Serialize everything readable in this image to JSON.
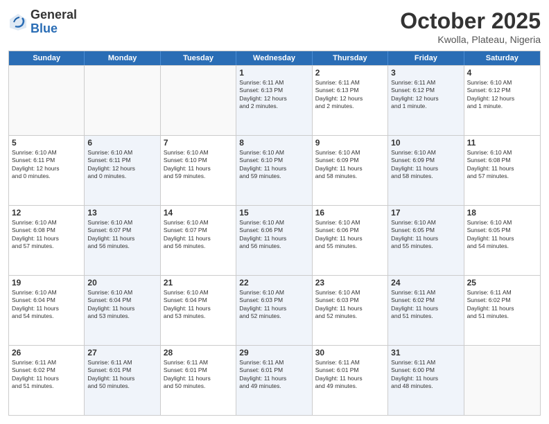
{
  "header": {
    "logo_general": "General",
    "logo_blue": "Blue",
    "month": "October 2025",
    "location": "Kwolla, Plateau, Nigeria"
  },
  "weekdays": [
    "Sunday",
    "Monday",
    "Tuesday",
    "Wednesday",
    "Thursday",
    "Friday",
    "Saturday"
  ],
  "rows": [
    [
      {
        "day": "",
        "info": "",
        "empty": true
      },
      {
        "day": "",
        "info": "",
        "empty": true
      },
      {
        "day": "",
        "info": "",
        "empty": true
      },
      {
        "day": "1",
        "info": "Sunrise: 6:11 AM\nSunset: 6:13 PM\nDaylight: 12 hours\nand 2 minutes.",
        "shaded": true
      },
      {
        "day": "2",
        "info": "Sunrise: 6:11 AM\nSunset: 6:13 PM\nDaylight: 12 hours\nand 2 minutes.",
        "shaded": false
      },
      {
        "day": "3",
        "info": "Sunrise: 6:11 AM\nSunset: 6:12 PM\nDaylight: 12 hours\nand 1 minute.",
        "shaded": true
      },
      {
        "day": "4",
        "info": "Sunrise: 6:10 AM\nSunset: 6:12 PM\nDaylight: 12 hours\nand 1 minute.",
        "shaded": false
      }
    ],
    [
      {
        "day": "5",
        "info": "Sunrise: 6:10 AM\nSunset: 6:11 PM\nDaylight: 12 hours\nand 0 minutes.",
        "shaded": false
      },
      {
        "day": "6",
        "info": "Sunrise: 6:10 AM\nSunset: 6:11 PM\nDaylight: 12 hours\nand 0 minutes.",
        "shaded": true
      },
      {
        "day": "7",
        "info": "Sunrise: 6:10 AM\nSunset: 6:10 PM\nDaylight: 11 hours\nand 59 minutes.",
        "shaded": false
      },
      {
        "day": "8",
        "info": "Sunrise: 6:10 AM\nSunset: 6:10 PM\nDaylight: 11 hours\nand 59 minutes.",
        "shaded": true
      },
      {
        "day": "9",
        "info": "Sunrise: 6:10 AM\nSunset: 6:09 PM\nDaylight: 11 hours\nand 58 minutes.",
        "shaded": false
      },
      {
        "day": "10",
        "info": "Sunrise: 6:10 AM\nSunset: 6:09 PM\nDaylight: 11 hours\nand 58 minutes.",
        "shaded": true
      },
      {
        "day": "11",
        "info": "Sunrise: 6:10 AM\nSunset: 6:08 PM\nDaylight: 11 hours\nand 57 minutes.",
        "shaded": false
      }
    ],
    [
      {
        "day": "12",
        "info": "Sunrise: 6:10 AM\nSunset: 6:08 PM\nDaylight: 11 hours\nand 57 minutes.",
        "shaded": false
      },
      {
        "day": "13",
        "info": "Sunrise: 6:10 AM\nSunset: 6:07 PM\nDaylight: 11 hours\nand 56 minutes.",
        "shaded": true
      },
      {
        "day": "14",
        "info": "Sunrise: 6:10 AM\nSunset: 6:07 PM\nDaylight: 11 hours\nand 56 minutes.",
        "shaded": false
      },
      {
        "day": "15",
        "info": "Sunrise: 6:10 AM\nSunset: 6:06 PM\nDaylight: 11 hours\nand 56 minutes.",
        "shaded": true
      },
      {
        "day": "16",
        "info": "Sunrise: 6:10 AM\nSunset: 6:06 PM\nDaylight: 11 hours\nand 55 minutes.",
        "shaded": false
      },
      {
        "day": "17",
        "info": "Sunrise: 6:10 AM\nSunset: 6:05 PM\nDaylight: 11 hours\nand 55 minutes.",
        "shaded": true
      },
      {
        "day": "18",
        "info": "Sunrise: 6:10 AM\nSunset: 6:05 PM\nDaylight: 11 hours\nand 54 minutes.",
        "shaded": false
      }
    ],
    [
      {
        "day": "19",
        "info": "Sunrise: 6:10 AM\nSunset: 6:04 PM\nDaylight: 11 hours\nand 54 minutes.",
        "shaded": false
      },
      {
        "day": "20",
        "info": "Sunrise: 6:10 AM\nSunset: 6:04 PM\nDaylight: 11 hours\nand 53 minutes.",
        "shaded": true
      },
      {
        "day": "21",
        "info": "Sunrise: 6:10 AM\nSunset: 6:04 PM\nDaylight: 11 hours\nand 53 minutes.",
        "shaded": false
      },
      {
        "day": "22",
        "info": "Sunrise: 6:10 AM\nSunset: 6:03 PM\nDaylight: 11 hours\nand 52 minutes.",
        "shaded": true
      },
      {
        "day": "23",
        "info": "Sunrise: 6:10 AM\nSunset: 6:03 PM\nDaylight: 11 hours\nand 52 minutes.",
        "shaded": false
      },
      {
        "day": "24",
        "info": "Sunrise: 6:11 AM\nSunset: 6:02 PM\nDaylight: 11 hours\nand 51 minutes.",
        "shaded": true
      },
      {
        "day": "25",
        "info": "Sunrise: 6:11 AM\nSunset: 6:02 PM\nDaylight: 11 hours\nand 51 minutes.",
        "shaded": false
      }
    ],
    [
      {
        "day": "26",
        "info": "Sunrise: 6:11 AM\nSunset: 6:02 PM\nDaylight: 11 hours\nand 51 minutes.",
        "shaded": false
      },
      {
        "day": "27",
        "info": "Sunrise: 6:11 AM\nSunset: 6:01 PM\nDaylight: 11 hours\nand 50 minutes.",
        "shaded": true
      },
      {
        "day": "28",
        "info": "Sunrise: 6:11 AM\nSunset: 6:01 PM\nDaylight: 11 hours\nand 50 minutes.",
        "shaded": false
      },
      {
        "day": "29",
        "info": "Sunrise: 6:11 AM\nSunset: 6:01 PM\nDaylight: 11 hours\nand 49 minutes.",
        "shaded": true
      },
      {
        "day": "30",
        "info": "Sunrise: 6:11 AM\nSunset: 6:01 PM\nDaylight: 11 hours\nand 49 minutes.",
        "shaded": false
      },
      {
        "day": "31",
        "info": "Sunrise: 6:11 AM\nSunset: 6:00 PM\nDaylight: 11 hours\nand 48 minutes.",
        "shaded": true
      },
      {
        "day": "",
        "info": "",
        "empty": true
      }
    ]
  ]
}
